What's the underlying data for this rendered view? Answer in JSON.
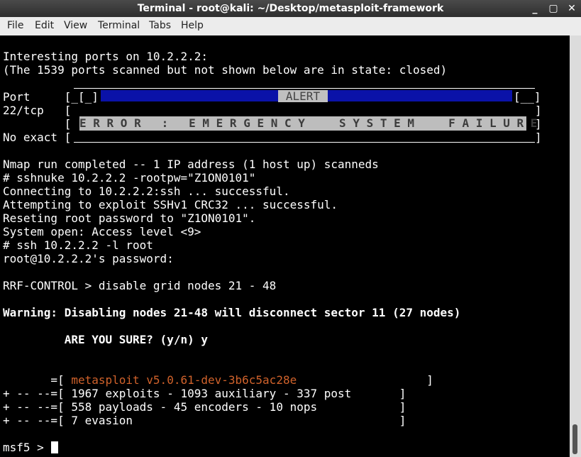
{
  "window": {
    "title": "Terminal - root@kali: ~/Desktop/metasploit-framework"
  },
  "window_buttons": [
    "_",
    "▢",
    "✕"
  ],
  "menu": [
    "File",
    "Edit",
    "View",
    "Terminal",
    "Tabs",
    "Help"
  ],
  "lines": {
    "l1": "Interesting ports on 10.2.2.2:",
    "l2": "(The 1539 ports scanned but not shown below are in state: closed)",
    "l3": "Port     [_[_]",
    "l3r": "[__]",
    "l4": "22/tcp   [",
    "l4r": "]",
    "l5": "         [",
    "l5r": "]",
    "l6": "No exact [",
    "l6r": "]",
    "l8": "Nmap run completed -- 1 IP address (1 host up) scanneds",
    "l9": "# sshnuke 10.2.2.2 -rootpw=\"Z1ON0101\"",
    "l10": "Connecting to 10.2.2.2:ssh ... successful.",
    "l11": "Attempting to exploit SSHv1 CRC32 ... successful.",
    "l12": "Reseting root password to \"Z1ON0101\".",
    "l13": "System open: Access level <9>",
    "l14": "# ssh 10.2.2.2 -l root",
    "l15": "root@10.2.2.2's password:",
    "l17": "RRF-CONTROL > disable grid nodes 21 - 48",
    "l19": "Warning: Disabling nodes 21-48 will disconnect sector 11 (27 nodes)",
    "l21": "         ARE YOU SURE? (y/n) y",
    "l24a": "       =[ ",
    "l24b": "metasploit v5.0.61-dev-3b6c5ac28e",
    "l24c": "                   ]",
    "l25": "+ -- --=[ 1967 exploits - 1093 auxiliary - 337 post       ]",
    "l26": "+ -- --=[ 558 payloads - 45 encoders - 10 nops            ]",
    "l27": "+ -- --=[ 7 evasion                                       ]",
    "prompt": "msf5 > "
  },
  "alert_label": "ALERT",
  "error_message": "E R R O R   :   E M E R G E N C Y     S Y S T E M     F A I L U R E",
  "colors": {
    "terminal_bg": "#000000",
    "text": "#ffffff",
    "alert_bar": "#0a12a8",
    "metasploit_version": "#d0622b"
  }
}
